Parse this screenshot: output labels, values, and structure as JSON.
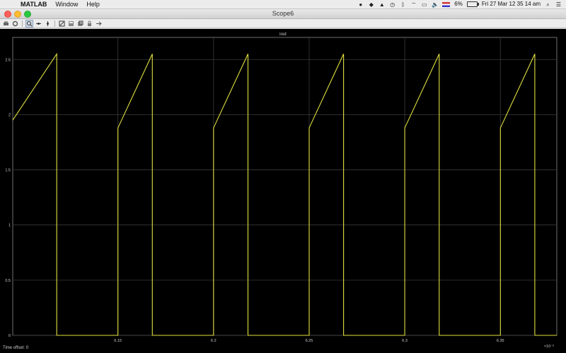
{
  "menubar": {
    "app_name": "MATLAB",
    "menus": [
      "Window",
      "Help"
    ],
    "battery": "6%",
    "datetime": "Fri 27 Mar  12 35 14 am"
  },
  "window": {
    "title": "Scope6"
  },
  "toolbar": {
    "buttons": [
      "print-icon",
      "parameters-icon",
      "zoom-icon",
      "zoom-x-icon",
      "zoom-y-icon",
      "autoscale-icon",
      "save-axes-icon",
      "restore-axes-icon",
      "lock-icon",
      "signal-select-icon"
    ]
  },
  "plot": {
    "title": "iout",
    "time_offset_label": "Time offset:",
    "time_offset_value": "0",
    "x_exponent": "×10⁻³"
  },
  "chart_data": {
    "type": "line",
    "title": "iout",
    "xlabel": "",
    "ylabel": "",
    "xlim": [
      6.095,
      6.3095
    ],
    "ylim": [
      0,
      2.7
    ],
    "x_tick_labels": [
      "6.15",
      "6.2",
      "6.25",
      "6.3",
      "6.35"
    ],
    "x_ticks": [
      6.15,
      6.2,
      6.25,
      6.3,
      6.35
    ],
    "y_tick_labels": [
      "0",
      "0.5",
      "1",
      "1.5",
      "2",
      "2.5"
    ],
    "y_ticks": [
      0,
      0.5,
      1,
      1.5,
      2,
      2.5
    ],
    "grid": true,
    "line_color": "#e0e040",
    "series": [
      {
        "x": [
          6.095,
          6.118,
          6.118,
          6.15,
          6.15,
          6.168,
          6.168,
          6.2,
          6.2,
          6.218,
          6.218,
          6.25,
          6.25,
          6.268,
          6.268,
          6.3,
          6.3,
          6.318,
          6.318,
          6.35,
          6.35,
          6.368,
          6.368,
          6.3795
        ],
        "values": [
          1.95,
          2.55,
          0,
          0,
          1.88,
          2.55,
          0,
          0,
          1.88,
          2.55,
          0,
          0,
          1.88,
          2.55,
          0,
          0,
          1.88,
          2.55,
          0,
          0,
          1.88,
          2.55,
          0,
          0
        ]
      }
    ]
  }
}
